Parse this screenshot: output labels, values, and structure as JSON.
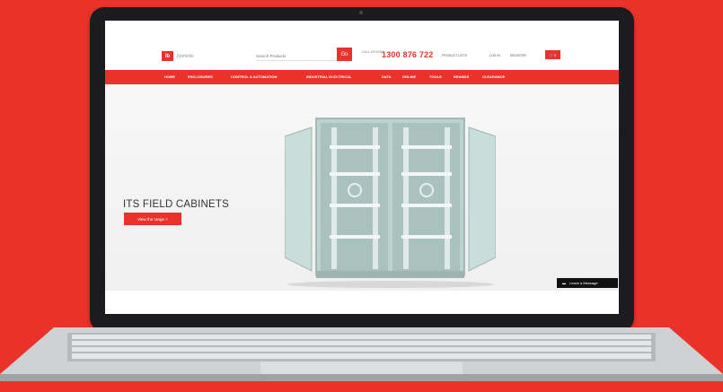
{
  "site": {
    "logo_text": "Jobfields",
    "search_placeholder": "Search Products",
    "search_button": "Go",
    "phone_label": "CALL US NOW",
    "phone": "1300 876 722",
    "links": [
      "PRODUCT LISTS",
      "LOG IN",
      "REGISTER"
    ],
    "cart": "0"
  },
  "nav": [
    "HOME",
    "ENCLOSURES",
    "CONTROL & AUTOMATION",
    "INDUSTRIAL ELECTRICAL",
    "DATA",
    "ONLINE",
    "TOOLS",
    "BRANDS",
    "CLEARANCE"
  ],
  "hero": {
    "title": "ITS FIELD CABINETS",
    "cta": "View the range >"
  },
  "chat": {
    "label": "Leave a Message"
  },
  "colors": {
    "accent": "#e8322a",
    "background": "#e8322a"
  }
}
